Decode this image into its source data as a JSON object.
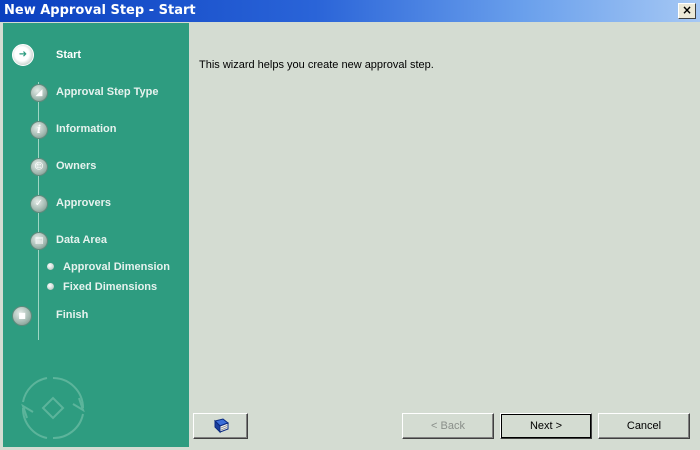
{
  "window": {
    "title": "New Approval Step - Start",
    "close_label": "×"
  },
  "sidebar": {
    "steps": [
      {
        "label": "Start",
        "icon": "arrow-right-icon",
        "active": true
      },
      {
        "label": "Approval Step Type",
        "icon": "type-icon"
      },
      {
        "label": "Information",
        "icon": "info-icon",
        "glyph": "i"
      },
      {
        "label": "Owners",
        "icon": "owners-icon"
      },
      {
        "label": "Approvers",
        "icon": "checkmark-icon"
      },
      {
        "label": "Data Area",
        "icon": "data-area-icon"
      }
    ],
    "substeps": [
      {
        "label": "Approval Dimension"
      },
      {
        "label": "Fixed Dimensions"
      }
    ],
    "finish": {
      "label": "Finish",
      "icon": "stop-icon"
    }
  },
  "content": {
    "intro": "This wizard helps you create new approval step."
  },
  "buttons": {
    "help_icon": "help-book-icon",
    "back": "< Back",
    "next": "Next >",
    "cancel": "Cancel"
  },
  "colors": {
    "sidebar": "#2e9c80",
    "content_bg": "#d4dcd2",
    "titlebar_start": "#0a3fbf"
  }
}
